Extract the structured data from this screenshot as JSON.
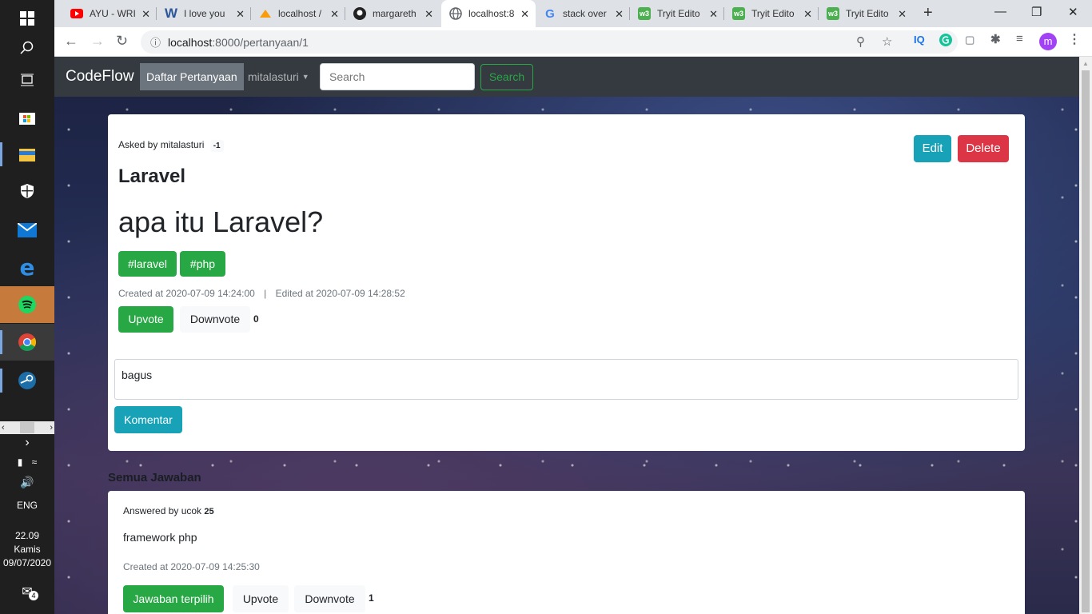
{
  "browser": {
    "tabs": [
      {
        "title": "AYU - WRI",
        "favicon": "youtube-icon"
      },
      {
        "title": "I love you",
        "favicon": "word-icon"
      },
      {
        "title": "localhost /",
        "favicon": "phpmyadmin-icon"
      },
      {
        "title": "margareth",
        "favicon": "github-icon"
      },
      {
        "title": "localhost:8",
        "favicon": "globe-icon",
        "active": true
      },
      {
        "title": "stack over",
        "favicon": "google-icon"
      },
      {
        "title": "Tryit Edito",
        "favicon": "w3schools-icon"
      },
      {
        "title": "Tryit Edito",
        "favicon": "w3schools-icon"
      },
      {
        "title": "Tryit Edito",
        "favicon": "w3schools-icon"
      }
    ],
    "url_host": "localhost",
    "url_rest": ":8000/pertanyaan/1",
    "avatar_letter": "m"
  },
  "taskbar": {
    "language": "ENG",
    "time": "22.09",
    "day": "Kamis",
    "date": "09/07/2020",
    "notification_count": "4"
  },
  "navbar": {
    "brand": "CodeFlow",
    "active_link": "Daftar Pertanyaan",
    "user": "mitalasturi",
    "search_placeholder": "Search",
    "search_button": "Search"
  },
  "question": {
    "asked_by_label": "Asked by mitalasturi",
    "asker_score": "-1",
    "edit_label": "Edit",
    "delete_label": "Delete",
    "title": "Laravel",
    "body": "apa itu Laravel?",
    "tags": [
      "#laravel",
      "#php"
    ],
    "created_label": "Created at 2020-07-09 14:24:00",
    "separator": "|",
    "edited_label": "Edited at 2020-07-09 14:28:52",
    "upvote_label": "Upvote",
    "downvote_label": "Downvote",
    "vote_count": "0",
    "comment_value": "bagus",
    "comment_button": "Komentar"
  },
  "answers": {
    "heading": "Semua Jawaban",
    "items": [
      {
        "answered_by_label": "Answered by ucok",
        "answerer_score": "25",
        "body": "framework php",
        "created_label": "Created at 2020-07-09 14:25:30",
        "chosen_label": "Jawaban terpilih",
        "upvote_label": "Upvote",
        "downvote_label": "Downvote",
        "vote_count": "1"
      }
    ]
  }
}
